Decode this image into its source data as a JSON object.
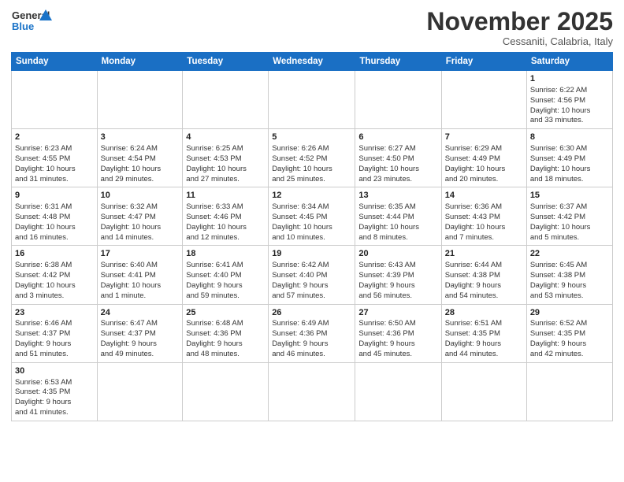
{
  "logo": {
    "general": "General",
    "blue": "Blue"
  },
  "header": {
    "month": "November 2025",
    "location": "Cessaniti, Calabria, Italy"
  },
  "days": [
    "Sunday",
    "Monday",
    "Tuesday",
    "Wednesday",
    "Thursday",
    "Friday",
    "Saturday"
  ],
  "weeks": [
    [
      {
        "day": "",
        "info": ""
      },
      {
        "day": "",
        "info": ""
      },
      {
        "day": "",
        "info": ""
      },
      {
        "day": "",
        "info": ""
      },
      {
        "day": "",
        "info": ""
      },
      {
        "day": "",
        "info": ""
      },
      {
        "day": "1",
        "info": "Sunrise: 6:22 AM\nSunset: 4:56 PM\nDaylight: 10 hours\nand 33 minutes."
      }
    ],
    [
      {
        "day": "2",
        "info": "Sunrise: 6:23 AM\nSunset: 4:55 PM\nDaylight: 10 hours\nand 31 minutes."
      },
      {
        "day": "3",
        "info": "Sunrise: 6:24 AM\nSunset: 4:54 PM\nDaylight: 10 hours\nand 29 minutes."
      },
      {
        "day": "4",
        "info": "Sunrise: 6:25 AM\nSunset: 4:53 PM\nDaylight: 10 hours\nand 27 minutes."
      },
      {
        "day": "5",
        "info": "Sunrise: 6:26 AM\nSunset: 4:52 PM\nDaylight: 10 hours\nand 25 minutes."
      },
      {
        "day": "6",
        "info": "Sunrise: 6:27 AM\nSunset: 4:50 PM\nDaylight: 10 hours\nand 23 minutes."
      },
      {
        "day": "7",
        "info": "Sunrise: 6:29 AM\nSunset: 4:49 PM\nDaylight: 10 hours\nand 20 minutes."
      },
      {
        "day": "8",
        "info": "Sunrise: 6:30 AM\nSunset: 4:49 PM\nDaylight: 10 hours\nand 18 minutes."
      }
    ],
    [
      {
        "day": "9",
        "info": "Sunrise: 6:31 AM\nSunset: 4:48 PM\nDaylight: 10 hours\nand 16 minutes."
      },
      {
        "day": "10",
        "info": "Sunrise: 6:32 AM\nSunset: 4:47 PM\nDaylight: 10 hours\nand 14 minutes."
      },
      {
        "day": "11",
        "info": "Sunrise: 6:33 AM\nSunset: 4:46 PM\nDaylight: 10 hours\nand 12 minutes."
      },
      {
        "day": "12",
        "info": "Sunrise: 6:34 AM\nSunset: 4:45 PM\nDaylight: 10 hours\nand 10 minutes."
      },
      {
        "day": "13",
        "info": "Sunrise: 6:35 AM\nSunset: 4:44 PM\nDaylight: 10 hours\nand 8 minutes."
      },
      {
        "day": "14",
        "info": "Sunrise: 6:36 AM\nSunset: 4:43 PM\nDaylight: 10 hours\nand 7 minutes."
      },
      {
        "day": "15",
        "info": "Sunrise: 6:37 AM\nSunset: 4:42 PM\nDaylight: 10 hours\nand 5 minutes."
      }
    ],
    [
      {
        "day": "16",
        "info": "Sunrise: 6:38 AM\nSunset: 4:42 PM\nDaylight: 10 hours\nand 3 minutes."
      },
      {
        "day": "17",
        "info": "Sunrise: 6:40 AM\nSunset: 4:41 PM\nDaylight: 10 hours\nand 1 minute."
      },
      {
        "day": "18",
        "info": "Sunrise: 6:41 AM\nSunset: 4:40 PM\nDaylight: 9 hours\nand 59 minutes."
      },
      {
        "day": "19",
        "info": "Sunrise: 6:42 AM\nSunset: 4:40 PM\nDaylight: 9 hours\nand 57 minutes."
      },
      {
        "day": "20",
        "info": "Sunrise: 6:43 AM\nSunset: 4:39 PM\nDaylight: 9 hours\nand 56 minutes."
      },
      {
        "day": "21",
        "info": "Sunrise: 6:44 AM\nSunset: 4:38 PM\nDaylight: 9 hours\nand 54 minutes."
      },
      {
        "day": "22",
        "info": "Sunrise: 6:45 AM\nSunset: 4:38 PM\nDaylight: 9 hours\nand 53 minutes."
      }
    ],
    [
      {
        "day": "23",
        "info": "Sunrise: 6:46 AM\nSunset: 4:37 PM\nDaylight: 9 hours\nand 51 minutes."
      },
      {
        "day": "24",
        "info": "Sunrise: 6:47 AM\nSunset: 4:37 PM\nDaylight: 9 hours\nand 49 minutes."
      },
      {
        "day": "25",
        "info": "Sunrise: 6:48 AM\nSunset: 4:36 PM\nDaylight: 9 hours\nand 48 minutes."
      },
      {
        "day": "26",
        "info": "Sunrise: 6:49 AM\nSunset: 4:36 PM\nDaylight: 9 hours\nand 46 minutes."
      },
      {
        "day": "27",
        "info": "Sunrise: 6:50 AM\nSunset: 4:36 PM\nDaylight: 9 hours\nand 45 minutes."
      },
      {
        "day": "28",
        "info": "Sunrise: 6:51 AM\nSunset: 4:35 PM\nDaylight: 9 hours\nand 44 minutes."
      },
      {
        "day": "29",
        "info": "Sunrise: 6:52 AM\nSunset: 4:35 PM\nDaylight: 9 hours\nand 42 minutes."
      }
    ],
    [
      {
        "day": "30",
        "info": "Sunrise: 6:53 AM\nSunset: 4:35 PM\nDaylight: 9 hours\nand 41 minutes."
      },
      {
        "day": "",
        "info": ""
      },
      {
        "day": "",
        "info": ""
      },
      {
        "day": "",
        "info": ""
      },
      {
        "day": "",
        "info": ""
      },
      {
        "day": "",
        "info": ""
      },
      {
        "day": "",
        "info": ""
      }
    ]
  ]
}
